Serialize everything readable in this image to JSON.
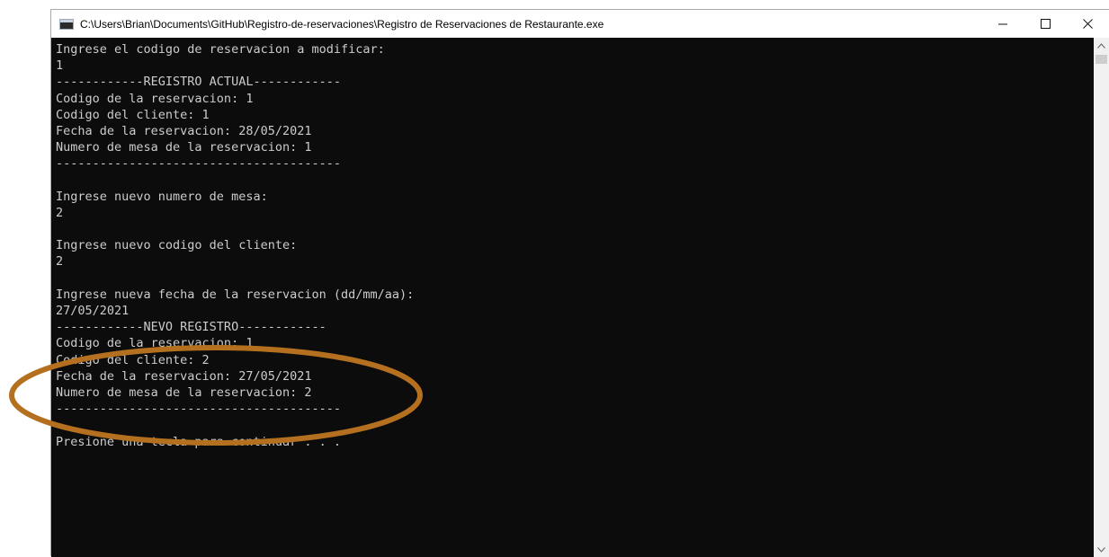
{
  "window": {
    "title": "C:\\Users\\Brian\\Documents\\GitHub\\Registro-de-reservaciones\\Registro de Reservaciones de Restaurante.exe",
    "icon": "console-app-icon",
    "controls": {
      "minimize_icon": "minimize-icon",
      "maximize_icon": "maximize-icon",
      "close_icon": "close-icon"
    }
  },
  "console": {
    "lines": [
      "Ingrese el codigo de reservacion a modificar:",
      "1",
      "------------REGISTRO ACTUAL------------",
      "Codigo de la reservacion: 1",
      "Codigo del cliente: 1",
      "Fecha de la reservacion: 28/05/2021",
      "Numero de mesa de la reservacion: 1",
      "---------------------------------------",
      "",
      "Ingrese nuevo numero de mesa:",
      "2",
      "",
      "Ingrese nuevo codigo del cliente:",
      "2",
      "",
      "Ingrese nueva fecha de la reservacion (dd/mm/aa):",
      "27/05/2021",
      "------------NEVO REGISTRO------------",
      "Codigo de la reservacion: 1",
      "Codigo del cliente: 2",
      "Fecha de la reservacion: 27/05/2021",
      "Numero de mesa de la reservacion: 2",
      "---------------------------------------",
      "",
      "Presione una tecla para continuar . . ."
    ]
  },
  "annotation": {
    "type": "ellipse",
    "color": "#b5701f"
  },
  "colors": {
    "console_bg": "#0c0c0c",
    "console_text": "#cccccc"
  }
}
